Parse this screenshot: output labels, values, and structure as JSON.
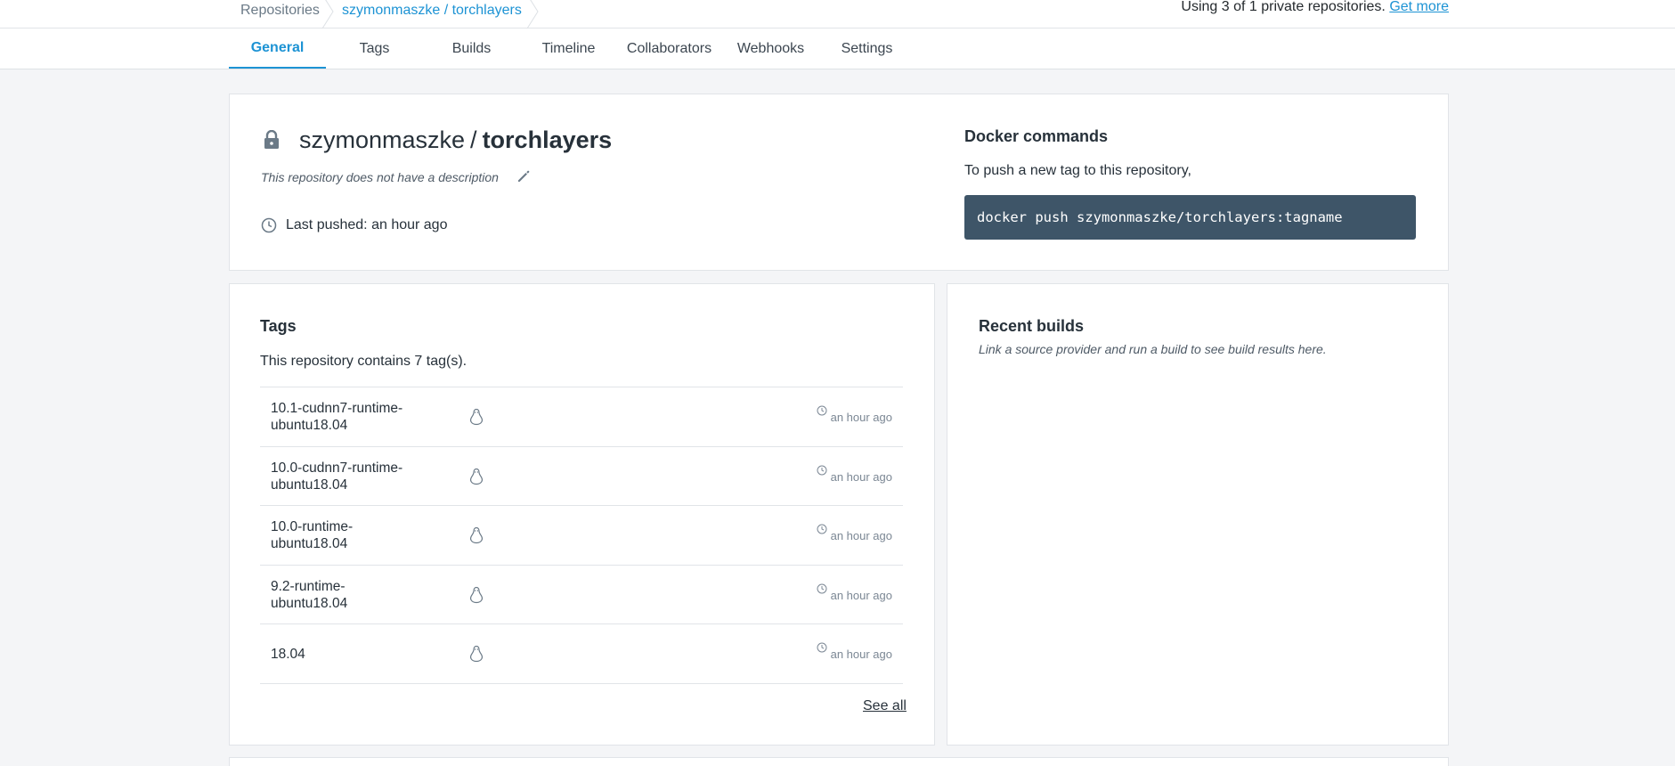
{
  "breadcrumb": {
    "repositories": "Repositories",
    "current": "szymonmaszke / torchlayers"
  },
  "usage": {
    "text": "Using 3 of 1 private repositories.",
    "link": "Get more"
  },
  "tabs": [
    {
      "label": "General",
      "active": true
    },
    {
      "label": "Tags"
    },
    {
      "label": "Builds"
    },
    {
      "label": "Timeline"
    },
    {
      "label": "Collaborators"
    },
    {
      "label": "Webhooks"
    },
    {
      "label": "Settings"
    }
  ],
  "repo": {
    "namespace": "szymonmaszke",
    "separator": "/",
    "name": "torchlayers",
    "description": "This repository does not have a description",
    "last_pushed": "Last pushed: an hour ago"
  },
  "docker": {
    "heading": "Docker commands",
    "text": "To push a new tag to this repository,",
    "command": "docker push szymonmaszke/torchlayers:tagname"
  },
  "tags": {
    "heading": "Tags",
    "count_text": "This repository contains 7 tag(s).",
    "rows": [
      {
        "name_line1": "10.1-cudnn7-runtime-",
        "name_line2": "ubuntu18.04",
        "time": "an hour ago"
      },
      {
        "name_line1": "10.0-cudnn7-runtime-",
        "name_line2": "ubuntu18.04",
        "time": "an hour ago"
      },
      {
        "name_line1": "10.0-runtime-",
        "name_line2": "ubuntu18.04",
        "time": "an hour ago"
      },
      {
        "name_line1": "9.2-runtime-",
        "name_line2": "ubuntu18.04",
        "time": "an hour ago"
      },
      {
        "name_line1": "18.04",
        "name_line2": "",
        "time": "an hour ago"
      }
    ],
    "see_all": "See all"
  },
  "builds": {
    "heading": "Recent builds",
    "text": "Link a source provider and run a build to see build results here."
  }
}
